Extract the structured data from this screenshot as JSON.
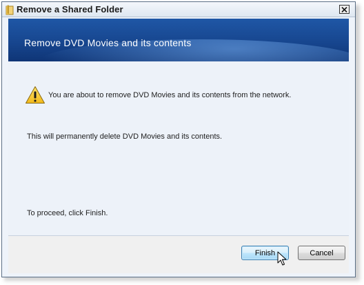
{
  "window": {
    "title": "Remove a Shared Folder",
    "close_label": "×"
  },
  "banner": {
    "title": "Remove DVD Movies and its contents"
  },
  "content": {
    "warning_text": "You are about to remove DVD Movies and its contents from the network.",
    "delete_text": "This will permanently delete DVD Movies and its contents.",
    "proceed_text": "To proceed, click Finish."
  },
  "buttons": {
    "finish_label": "Finish",
    "cancel_label": "Cancel"
  },
  "colors": {
    "banner": "#17468f",
    "content_bg": "#edf2f9",
    "focus_border": "#3c7fb1"
  }
}
